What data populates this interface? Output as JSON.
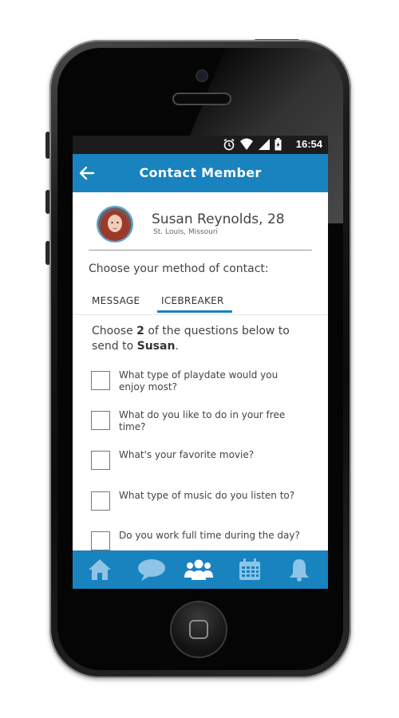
{
  "status_bar": {
    "time": "16:54"
  },
  "app_bar": {
    "title": "Contact Member"
  },
  "profile": {
    "name": "Susan Reynolds, 28",
    "location": "St. Louis, Missouri"
  },
  "contact": {
    "prompt": "Choose your method of contact:"
  },
  "tabs": [
    {
      "label": "MESSAGE",
      "active": false
    },
    {
      "label": "ICEBREAKER",
      "active": true
    }
  ],
  "instructions": {
    "before": "Choose ",
    "count": "2",
    "middle": " of the questions below to send to ",
    "name": "Susan",
    "after": "."
  },
  "questions": [
    "What type of playdate would you enjoy most?",
    "What do you like to do in your free time?",
    "What's your favorite movie?",
    "What type of music do you listen to?",
    "Do you work full time during the day?"
  ],
  "bottom_nav": [
    "home-icon",
    "chat-icon",
    "group-icon",
    "calendar-icon",
    "bell-icon"
  ],
  "colors": {
    "primary": "#1883bf",
    "status_bar": "#1c1c1c",
    "nav_icon": "#8ec4e6"
  }
}
